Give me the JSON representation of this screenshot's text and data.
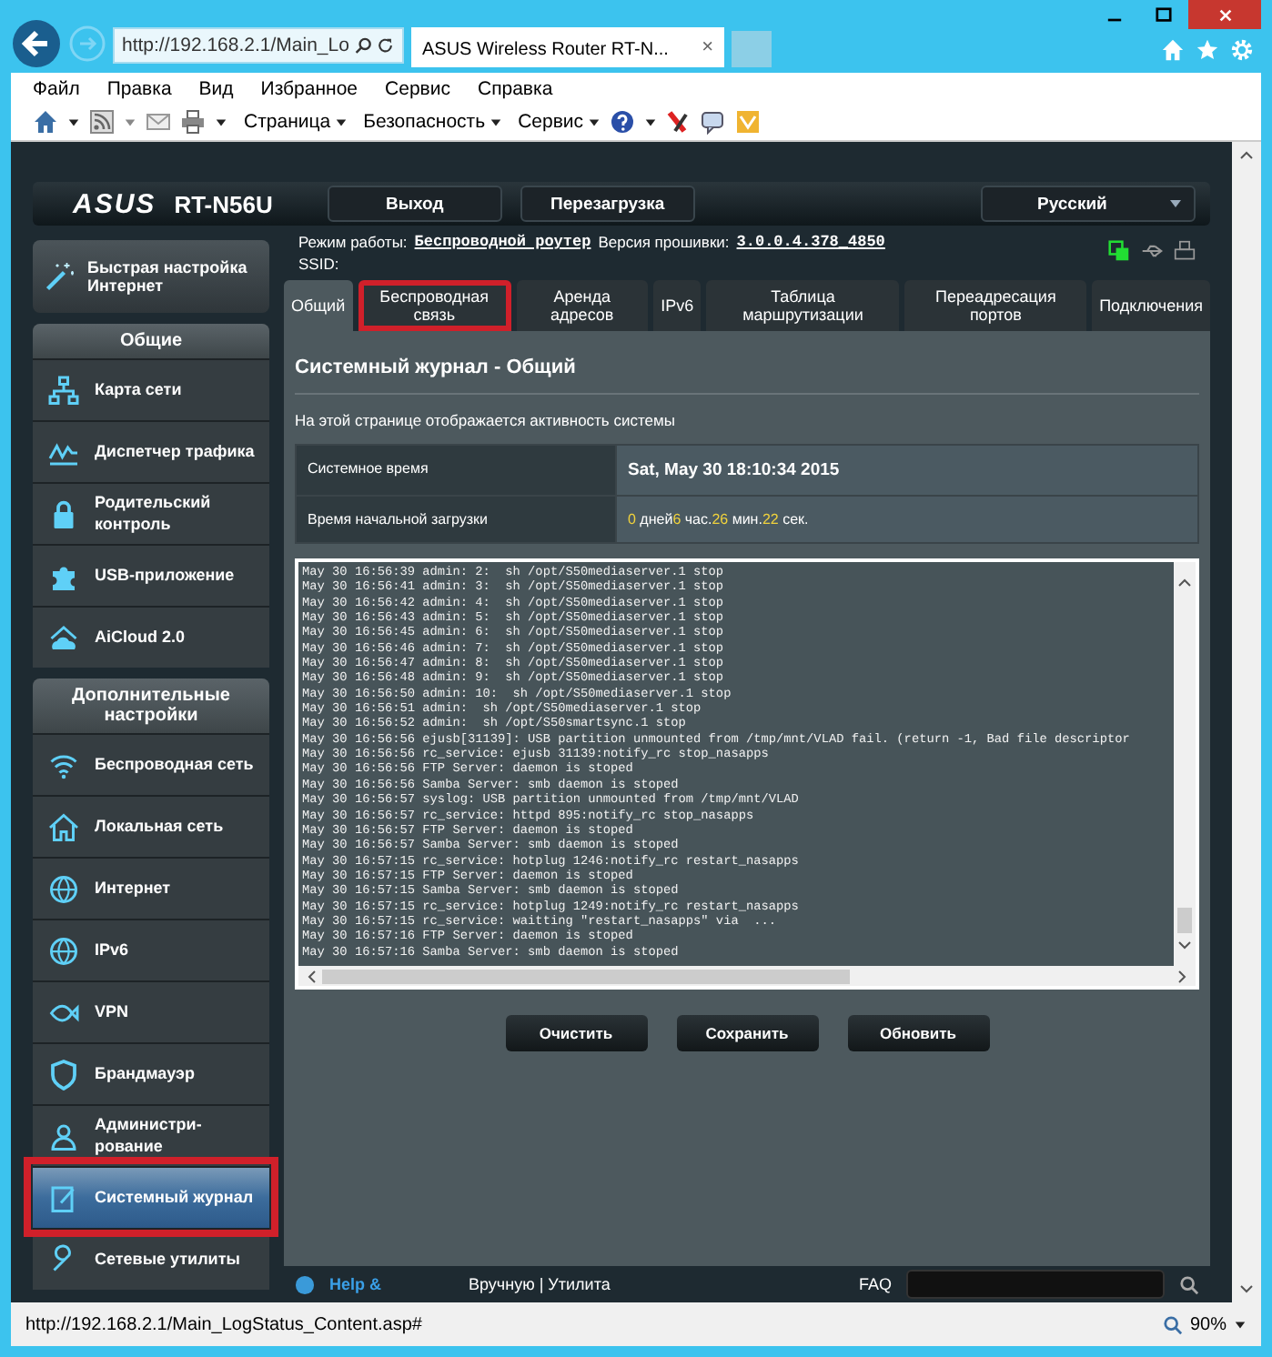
{
  "browser": {
    "address": "http://192.168.2.1/Main_Lo",
    "tab_title": "ASUS Wireless Router RT-N...",
    "tab_close": "×",
    "menu": [
      "Файл",
      "Правка",
      "Вид",
      "Избранное",
      "Сервис",
      "Справка"
    ],
    "toolbar": [
      "Страница",
      "Безопасность",
      "Сервис"
    ],
    "status_url": "http://192.168.2.1/Main_LogStatus_Content.asp#",
    "zoom": "90%"
  },
  "router": {
    "logo": "ASUS",
    "model": "RT-N56U",
    "buttons": [
      "Выход",
      "Перезагрузка"
    ],
    "language": "Русский",
    "mode_label": "Режим работы:",
    "mode": "Беспроводной роутер",
    "fw_label": "Версия прошивки:",
    "fw": "3.0.0.4.378_4850",
    "ssid_label": "SSID:"
  },
  "sidebar": {
    "quick_setup": "Быстрая настройка Интернет",
    "sections": [
      {
        "title": "Общие",
        "items": [
          {
            "label": "Карта сети",
            "selected": false,
            "highlighted": false
          },
          {
            "label": "Диспетчер трафика",
            "selected": false,
            "highlighted": false
          },
          {
            "label": "Родительский контроль",
            "selected": false,
            "highlighted": false
          },
          {
            "label": "USB-приложение",
            "selected": false,
            "highlighted": false
          },
          {
            "label": "AiCloud 2.0",
            "selected": false,
            "highlighted": false
          }
        ]
      },
      {
        "title": "Дополнительные настройки",
        "items": [
          {
            "label": "Беспроводная сеть",
            "selected": false,
            "highlighted": false
          },
          {
            "label": "Локальная сеть",
            "selected": false,
            "highlighted": false
          },
          {
            "label": "Интернет",
            "selected": false,
            "highlighted": false
          },
          {
            "label": "IPv6",
            "selected": false,
            "highlighted": false
          },
          {
            "label": "VPN",
            "selected": false,
            "highlighted": false
          },
          {
            "label": "Брандмауэр",
            "selected": false,
            "highlighted": false
          },
          {
            "label": "Администри-рование",
            "selected": false,
            "highlighted": false
          },
          {
            "label": "Системный журнал",
            "selected": true,
            "highlighted": true
          },
          {
            "label": "Сетевые утилиты",
            "selected": false,
            "highlighted": false
          }
        ]
      }
    ]
  },
  "tabs": [
    {
      "label": "Общий",
      "selected": true,
      "highlighted": false
    },
    {
      "label": "Беспроводная связь",
      "selected": false,
      "highlighted": true
    },
    {
      "label": "Аренда адресов",
      "selected": false,
      "highlighted": false
    },
    {
      "label": "IPv6",
      "selected": false,
      "highlighted": false
    },
    {
      "label": "Таблица маршрутизации",
      "selected": false,
      "highlighted": false
    },
    {
      "label": "Переадресация портов",
      "selected": false,
      "highlighted": false
    },
    {
      "label": "Подключения",
      "selected": false,
      "highlighted": false
    }
  ],
  "panel": {
    "title": "Системный журнал - Общий",
    "description": "На этой странице отображается активность системы",
    "system_time": {
      "label": "Системное время",
      "value": "Sat, May 30 18:10:34 2015"
    },
    "uptime": {
      "label": "Время начальной загрузки",
      "parts": [
        {
          "value": "0",
          "unit": "дней"
        },
        {
          "value": "6",
          "unit": "час."
        },
        {
          "value": "26",
          "unit": "мин."
        },
        {
          "value": "22",
          "unit": "сек."
        }
      ]
    },
    "log": [
      "May 30 16:56:39 admin: 2:  sh /opt/S50mediaserver.1 stop",
      "May 30 16:56:41 admin: 3:  sh /opt/S50mediaserver.1 stop",
      "May 30 16:56:42 admin: 4:  sh /opt/S50mediaserver.1 stop",
      "May 30 16:56:43 admin: 5:  sh /opt/S50mediaserver.1 stop",
      "May 30 16:56:45 admin: 6:  sh /opt/S50mediaserver.1 stop",
      "May 30 16:56:46 admin: 7:  sh /opt/S50mediaserver.1 stop",
      "May 30 16:56:47 admin: 8:  sh /opt/S50mediaserver.1 stop",
      "May 30 16:56:48 admin: 9:  sh /opt/S50mediaserver.1 stop",
      "May 30 16:56:50 admin: 10:  sh /opt/S50mediaserver.1 stop",
      "May 30 16:56:51 admin:  sh /opt/S50mediaserver.1 stop",
      "May 30 16:56:52 admin:  sh /opt/S50smartsync.1 stop",
      "May 30 16:56:56 ejusb[31139]: USB partition unmounted from /tmp/mnt/VLAD fail. (return -1, Bad file descriptor",
      "May 30 16:56:56 rc_service: ejusb 31139:notify_rc stop_nasapps",
      "May 30 16:56:56 FTP Server: daemon is stoped",
      "May 30 16:56:56 Samba Server: smb daemon is stoped",
      "May 30 16:56:57 syslog: USB partition unmounted from /tmp/mnt/VLAD",
      "May 30 16:56:57 rc_service: httpd 895:notify_rc stop_nasapps",
      "May 30 16:56:57 FTP Server: daemon is stoped",
      "May 30 16:56:57 Samba Server: smb daemon is stoped",
      "May 30 16:57:15 rc_service: hotplug 1246:notify_rc restart_nasapps",
      "May 30 16:57:15 FTP Server: daemon is stoped",
      "May 30 16:57:15 Samba Server: smb daemon is stoped",
      "May 30 16:57:15 rc_service: hotplug 1249:notify_rc restart_nasapps",
      "May 30 16:57:15 rc_service: waitting \"restart_nasapps\" via  ...",
      "May 30 16:57:16 FTP Server: daemon is stoped",
      "May 30 16:57:16 Samba Server: smb daemon is stoped"
    ],
    "buttons": [
      "Очистить",
      "Сохранить",
      "Обновить"
    ]
  },
  "footer": {
    "help": "Help &",
    "links": "Вручную | Утилита",
    "faq": "FAQ"
  }
}
